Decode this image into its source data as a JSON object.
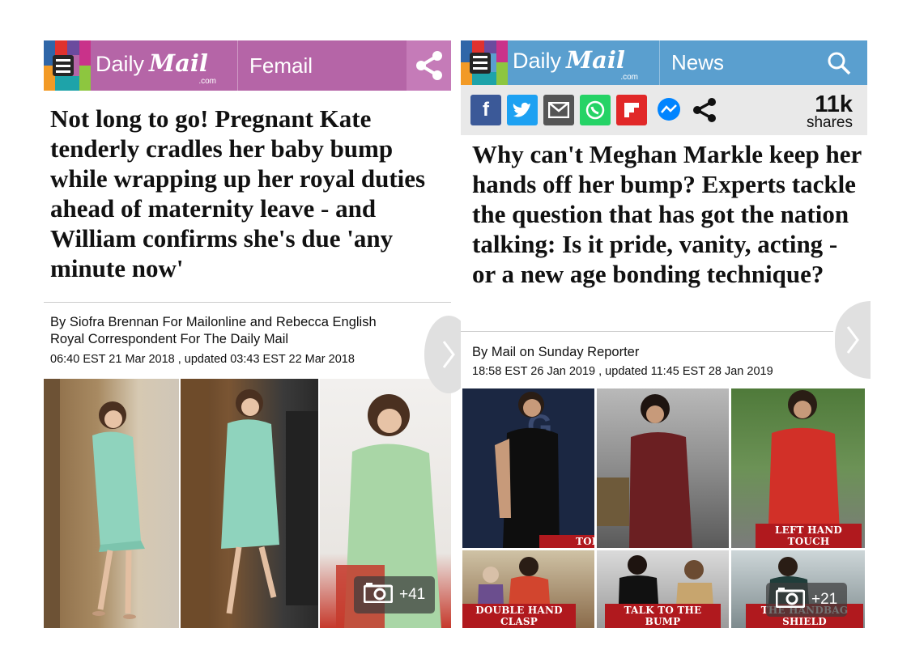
{
  "left": {
    "logo": {
      "daily": "Daily",
      "mail": "Mail",
      "com": ".com"
    },
    "section": "Femail",
    "header_color": "#b565a7",
    "share_icon": "share-icon",
    "headline": "Not long to go! Pregnant Kate tenderly cradles her baby bump while wrapping up her royal duties ahead of maternity leave - and William confirms she's due 'any minute now'",
    "byline_1": "By Siofra Brennan For Mailonline and Rebecca English",
    "byline_2": "Royal Correspondent For The Daily Mail",
    "date": "06:40 EST 21 Mar 2018 , updated 03:43 EST 22 Mar 2018",
    "gallery_count": "+41"
  },
  "right": {
    "logo": {
      "daily": "Daily",
      "mail": "Mail",
      "com": ".com"
    },
    "section": "News",
    "header_color": "#5a9fcf",
    "search_icon": "search-icon",
    "share_buttons": [
      {
        "name": "facebook-icon",
        "glyph": "f",
        "color": "#3b5998"
      },
      {
        "name": "twitter-icon",
        "glyph": "t",
        "color": "#1da1f2"
      },
      {
        "name": "email-icon",
        "glyph": "✉",
        "color": "#555555"
      },
      {
        "name": "whatsapp-icon",
        "glyph": "✆",
        "color": "#25d366"
      },
      {
        "name": "flipboard-icon",
        "glyph": "F",
        "color": "#e12828"
      },
      {
        "name": "messenger-icon",
        "glyph": "⚡",
        "color": "#0084ff"
      }
    ],
    "share_count": "11k",
    "share_label": "shares",
    "headline": "Why can't Meghan Markle keep her hands off her bump? Experts tackle the question that has got the nation talking: Is it pride, vanity, acting - or a new age bonding technique?",
    "byline": "By Mail on Sunday Reporter",
    "date": "18:58 EST 26 Jan 2019 , updated 11:45 EST 28 Jan 2019",
    "captions": [
      "TOP AND TOE HOLD",
      "LEFT HAND TOUCH",
      "DOUBLE HAND CLASP",
      "TALK TO THE BUMP",
      "THE HANDBAG SHIELD"
    ],
    "gallery_count": "+21"
  }
}
